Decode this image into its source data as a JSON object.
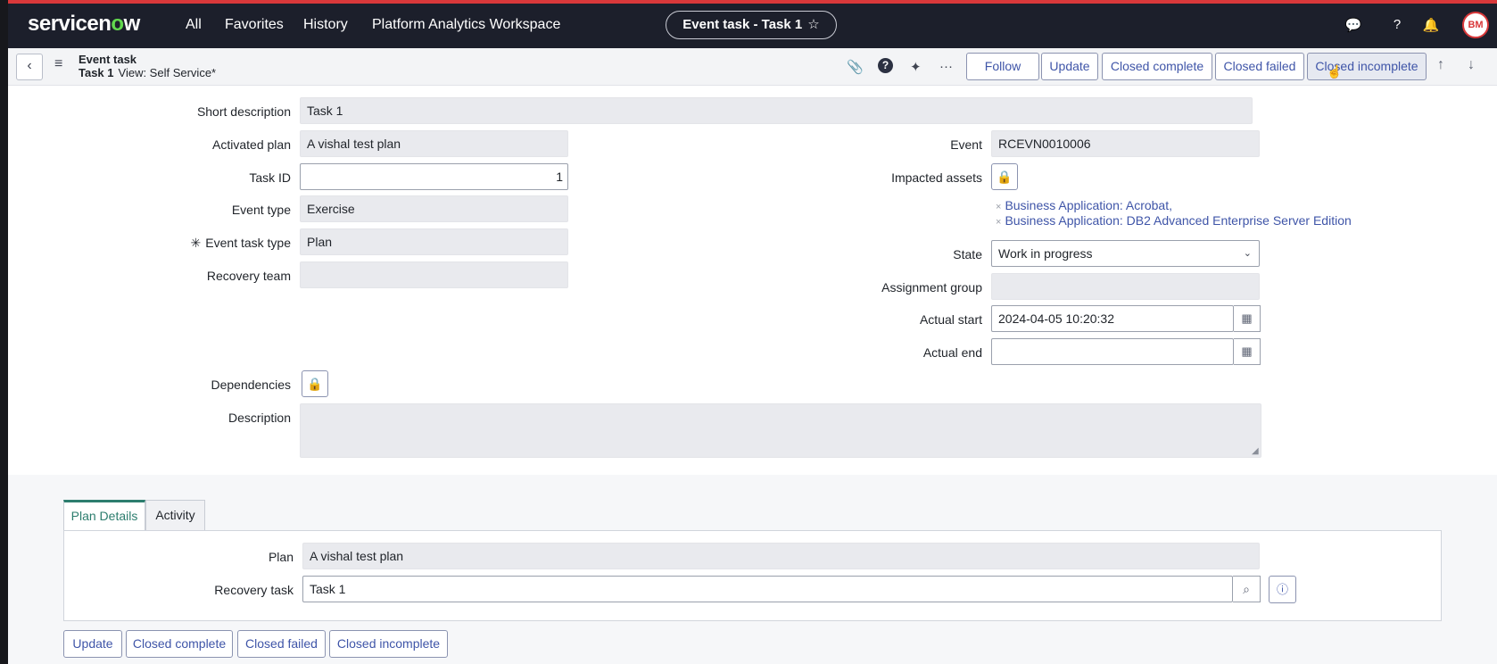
{
  "topnav": {
    "brand_pre": "servicen",
    "brand_o": "o",
    "brand_post": "w",
    "items": [
      "All",
      "Favorites",
      "History",
      "Platform Analytics Workspace"
    ],
    "context_title": "Event task - Task 1",
    "avatar_initials": "BM"
  },
  "header": {
    "table_name": "Event task",
    "record": "Task 1",
    "view": "View: Self Service*",
    "buttons": [
      "Follow",
      "Update",
      "Closed complete",
      "Closed failed",
      "Closed incomplete"
    ]
  },
  "form": {
    "short_description": {
      "label": "Short description",
      "value": "Task 1"
    },
    "activated_plan": {
      "label": "Activated plan",
      "value": "A vishal test plan"
    },
    "task_id": {
      "label": "Task ID",
      "value": "1"
    },
    "event_type": {
      "label": "Event type",
      "value": "Exercise"
    },
    "event_task_type": {
      "label": "Event task type",
      "required_mark": "✳",
      "value": "Plan"
    },
    "recovery_team": {
      "label": "Recovery team",
      "value": ""
    },
    "event": {
      "label": "Event",
      "value": "RCEVN0010006"
    },
    "impacted_assets": {
      "label": "Impacted assets",
      "items": [
        "Business Application: Acrobat,",
        "Business Application: DB2 Advanced Enterprise Server Edition"
      ]
    },
    "state": {
      "label": "State",
      "value": "Work in progress"
    },
    "assignment_group": {
      "label": "Assignment group",
      "value": ""
    },
    "actual_start": {
      "label": "Actual start",
      "value": "2024-04-05 10:20:32"
    },
    "actual_end": {
      "label": "Actual end",
      "value": ""
    },
    "dependencies": {
      "label": "Dependencies"
    },
    "description": {
      "label": "Description",
      "value": ""
    }
  },
  "related": {
    "tabs": [
      "Plan Details",
      "Activity"
    ],
    "plan": {
      "label": "Plan",
      "value": "A vishal test plan"
    },
    "recovery_task": {
      "label": "Recovery task",
      "value": "Task 1"
    }
  },
  "footer": {
    "buttons": [
      "Update",
      "Closed complete",
      "Closed failed",
      "Closed incomplete"
    ]
  }
}
